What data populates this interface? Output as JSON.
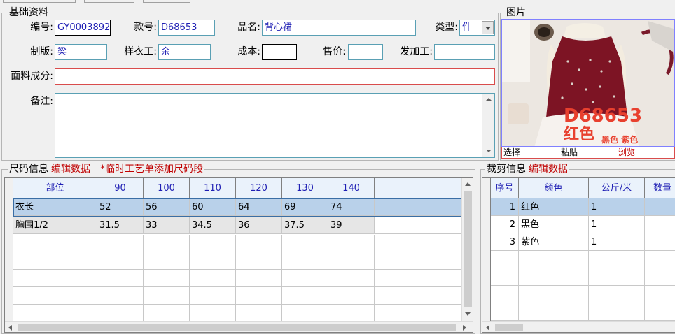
{
  "basic_info": {
    "title": "基础资料",
    "code_label": "编号:",
    "code_value": "GY0003892",
    "style_no_label": "款号:",
    "style_no_value": "D68653",
    "product_name_label": "品名:",
    "product_name_value": "背心裙",
    "type_label": "类型:",
    "type_value": "件",
    "pattern_label": "制版:",
    "pattern_value": "梁",
    "sample_worker_label": "样衣工:",
    "sample_worker_value": "余",
    "cost_label": "成本:",
    "cost_value": "",
    "price_label": "售价:",
    "price_value": "",
    "processor_label": "发加工:",
    "processor_value": "",
    "fabric_label": "面料成分:",
    "fabric_value": "",
    "notes_label": "备注:",
    "notes_value": ""
  },
  "picture": {
    "title": "图片",
    "overlay_code": "D68653",
    "overlay_color": "红色",
    "overlay_colors_small": "黑色 紫色",
    "select_label": "选择",
    "paste_label": "粘贴",
    "browse_label": "浏览"
  },
  "size_info": {
    "title": "尺码信息",
    "edit_label": "编辑数据",
    "note": "*临时工艺单添加尺码段",
    "columns": [
      "部位",
      "90",
      "100",
      "110",
      "120",
      "130",
      "140"
    ],
    "rows": [
      [
        "衣长",
        "52",
        "56",
        "60",
        "64",
        "69",
        "74"
      ],
      [
        "胸围1/2",
        "31.5",
        "33",
        "34.5",
        "36",
        "37.5",
        "39"
      ]
    ]
  },
  "cut_info": {
    "title": "裁剪信息",
    "edit_label": "编辑数据",
    "columns": [
      "序号",
      "颜色",
      "公斤/米",
      "数量"
    ],
    "rows": [
      [
        "1",
        "红色",
        "1",
        ""
      ],
      [
        "2",
        "黑色",
        "1",
        ""
      ],
      [
        "3",
        "紫色",
        "1",
        ""
      ]
    ]
  },
  "colors": {
    "accent_red": "#c00000",
    "field_border": "#5aa0b4",
    "field_text": "#1f1fb4",
    "selected_row": "#b9d1ea"
  }
}
